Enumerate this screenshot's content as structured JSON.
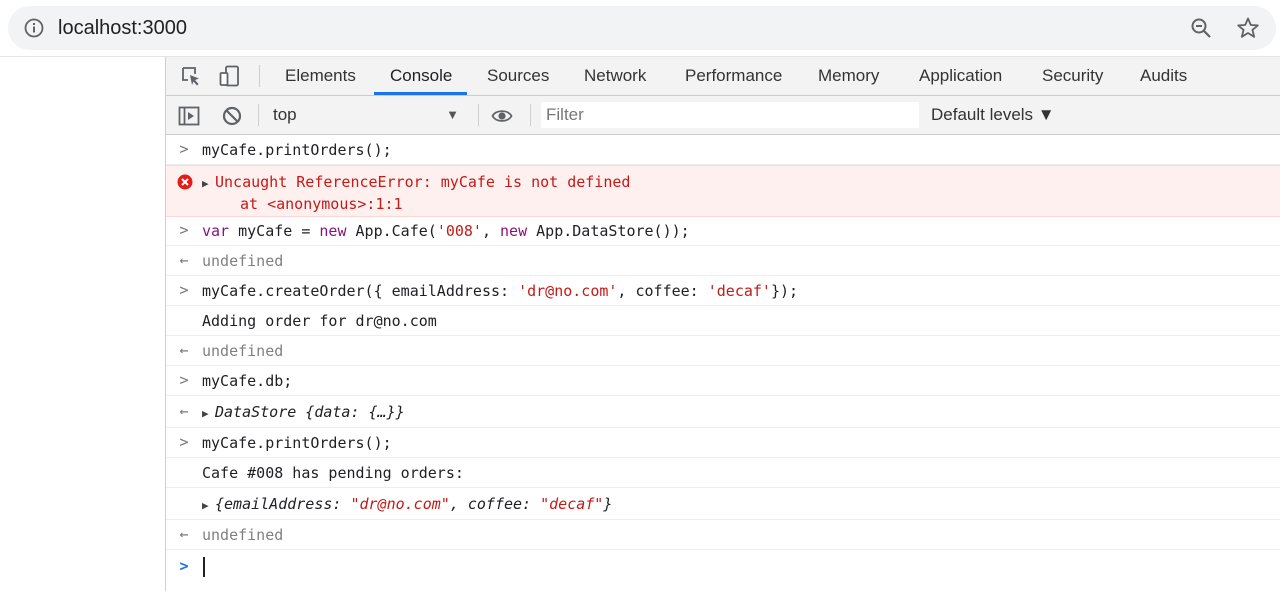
{
  "browser": {
    "url_text": "localhost:3000",
    "icons": [
      "info-icon",
      "zoom-icon",
      "star-icon"
    ]
  },
  "devtools": {
    "tabs": [
      "Elements",
      "Console",
      "Sources",
      "Network",
      "Performance",
      "Memory",
      "Application",
      "Security",
      "Audits"
    ],
    "active_tab": "Console",
    "toolbar": {
      "context": "top",
      "filter_placeholder": "Filter",
      "levels": "Default levels ▼"
    },
    "colors": {
      "accent": "#1a73e8",
      "error_text": "#c41a16",
      "keyword": "#881280",
      "error_background": "#fff0f0"
    }
  },
  "console": {
    "lines": [
      {
        "kind": "input",
        "text": "myCafe.printOrders();"
      },
      {
        "kind": "error",
        "text": "Uncaught ReferenceError: myCafe is not defined",
        "detail": "at <anonymous>:1:1"
      },
      {
        "kind": "input",
        "parts": [
          "var",
          " myCafe = ",
          "new",
          " App.Cafe(",
          "'008'",
          ", ",
          "new",
          " App.DataStore());"
        ]
      },
      {
        "kind": "result",
        "text": "undefined"
      },
      {
        "kind": "input",
        "parts": [
          "myCafe.createOrder({ emailAddress: ",
          "'dr@no.com'",
          ", coffee: ",
          "'decaf'",
          "});"
        ]
      },
      {
        "kind": "log",
        "text": "Adding order for dr@no.com"
      },
      {
        "kind": "result",
        "text": "undefined"
      },
      {
        "kind": "input",
        "text": "myCafe.db;"
      },
      {
        "kind": "result-object",
        "text": "DataStore {data: {…}}"
      },
      {
        "kind": "input",
        "text": "myCafe.printOrders();"
      },
      {
        "kind": "log",
        "text": "Cafe #008 has pending orders:"
      },
      {
        "kind": "log-object",
        "parts": [
          "{emailAddress: ",
          "\"dr@no.com\"",
          ", coffee: ",
          "\"decaf\"",
          "}"
        ]
      },
      {
        "kind": "result",
        "text": "undefined"
      }
    ]
  }
}
